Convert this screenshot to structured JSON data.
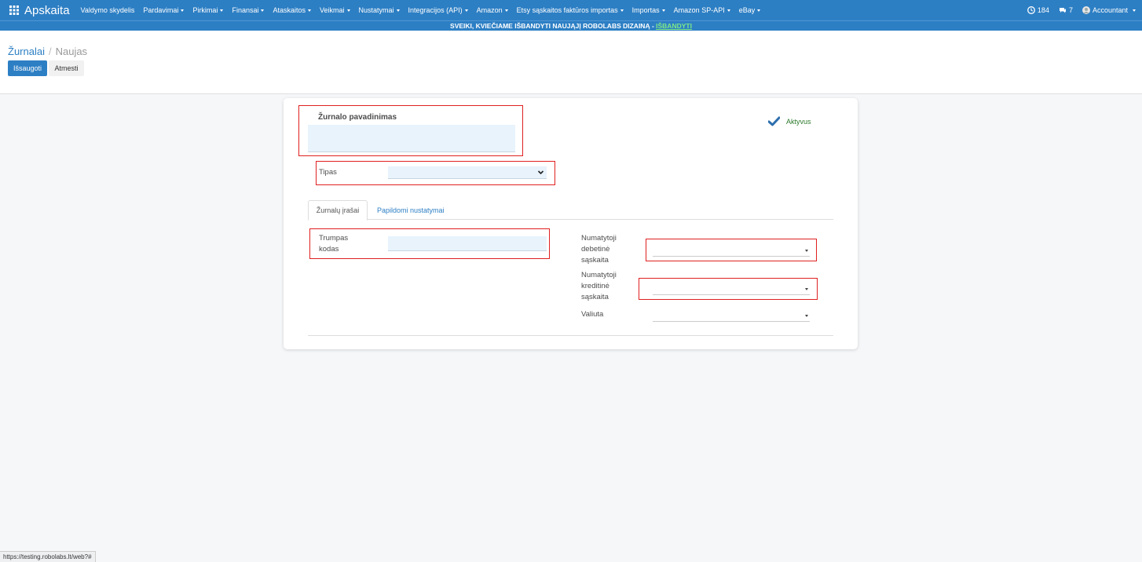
{
  "nav": {
    "brand": "Apskaita",
    "menu": [
      {
        "label": "Valdymo skydelis",
        "dropdown": false
      },
      {
        "label": "Pardavimai",
        "dropdown": true
      },
      {
        "label": "Pirkimai",
        "dropdown": true
      },
      {
        "label": "Finansai",
        "dropdown": true
      },
      {
        "label": "Ataskaitos",
        "dropdown": true
      },
      {
        "label": "Veikmai",
        "dropdown": true
      },
      {
        "label": "Nustatymai",
        "dropdown": true
      },
      {
        "label": "Integracijos (API)",
        "dropdown": true
      },
      {
        "label": "Amazon",
        "dropdown": true
      },
      {
        "label": "Etsy sąskaitos faktūros importas",
        "dropdown": true
      },
      {
        "label": "Importas",
        "dropdown": true
      },
      {
        "label": "Amazon SP-API",
        "dropdown": true
      },
      {
        "label": "eBay",
        "dropdown": true
      }
    ],
    "right": {
      "notifications_count": "184",
      "messages_count": "7",
      "user": "Accountant"
    }
  },
  "announcement": {
    "text": "SVEIKI, KVIEČIAME IŠBANDYTI NAUJĄJĮ ROBOLABS DIZAINĄ - ",
    "link": "IŠBANDYTI"
  },
  "breadcrumb": {
    "parent": "Žurnalai",
    "separator": "/",
    "current": "Naujas"
  },
  "buttons": {
    "save": "Išsaugoti",
    "discard": "Atmesti"
  },
  "form": {
    "name_label": "Žurnalo pavadinimas",
    "name_value": "",
    "active_label": "Aktyvus",
    "type_label": "Tipas",
    "type_value": "",
    "tabs": [
      "Žurnalų įrašai",
      "Papildomi nustatymai"
    ],
    "short_code_label": "Trumpas kodas",
    "short_code_value": "",
    "debit_account_label": "Numatytoji debetinė sąskaita",
    "credit_account_label": "Numatytoji kreditinė sąskaita",
    "currency_label": "Valiuta"
  },
  "statusbar": {
    "url": "https://testing.robolabs.lt/web?#"
  },
  "colors": {
    "primary": "#2d7fc4",
    "highlight": "#e02020",
    "input_bg": "#e8f3fc",
    "active": "#2c7a2c"
  }
}
